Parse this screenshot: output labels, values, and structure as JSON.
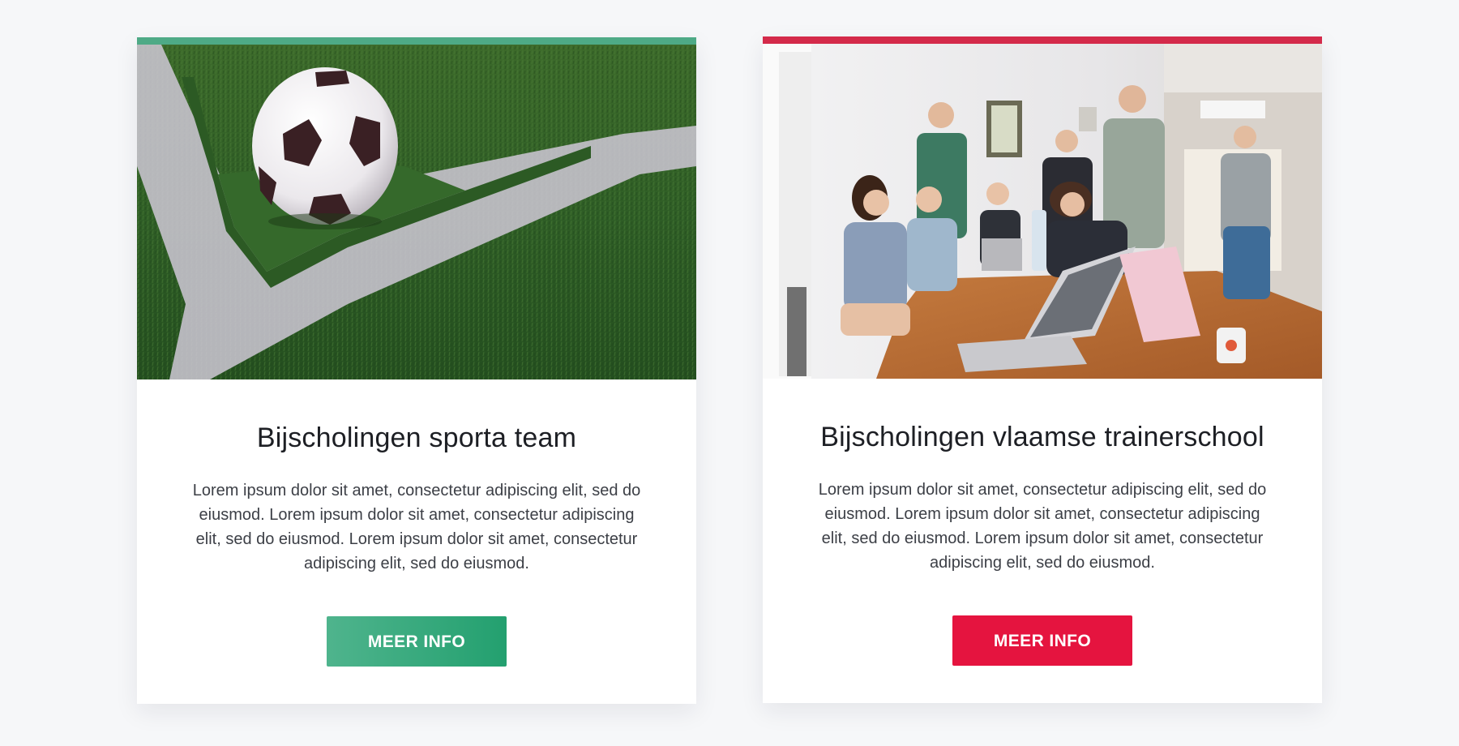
{
  "cards": [
    {
      "title": "Bijscholingen sporta team",
      "text": "Lorem ipsum dolor sit amet, consectetur adipiscing elit, sed do eiusmod. Lorem ipsum dolor sit amet, consectetur adipiscing elit, sed do eiusmod. Lorem ipsum dolor sit amet, consectetur adipiscing elit, sed do eiusmod.",
      "button_label": "MEER INFO",
      "accent_color": "#4eaa86",
      "image_subject": "soccer ball on corner of grass field"
    },
    {
      "title": "Bijscholingen vlaamse trainerschool",
      "text": "Lorem ipsum dolor sit amet, consectetur adipiscing elit, sed do eiusmod. Lorem ipsum dolor sit amet, consectetur adipiscing elit, sed do eiusmod. Lorem ipsum dolor sit amet, consectetur adipiscing elit, sed do eiusmod.",
      "button_label": "MEER INFO",
      "accent_color": "#d42a4a",
      "image_subject": "group of people around laptops at a table"
    }
  ]
}
